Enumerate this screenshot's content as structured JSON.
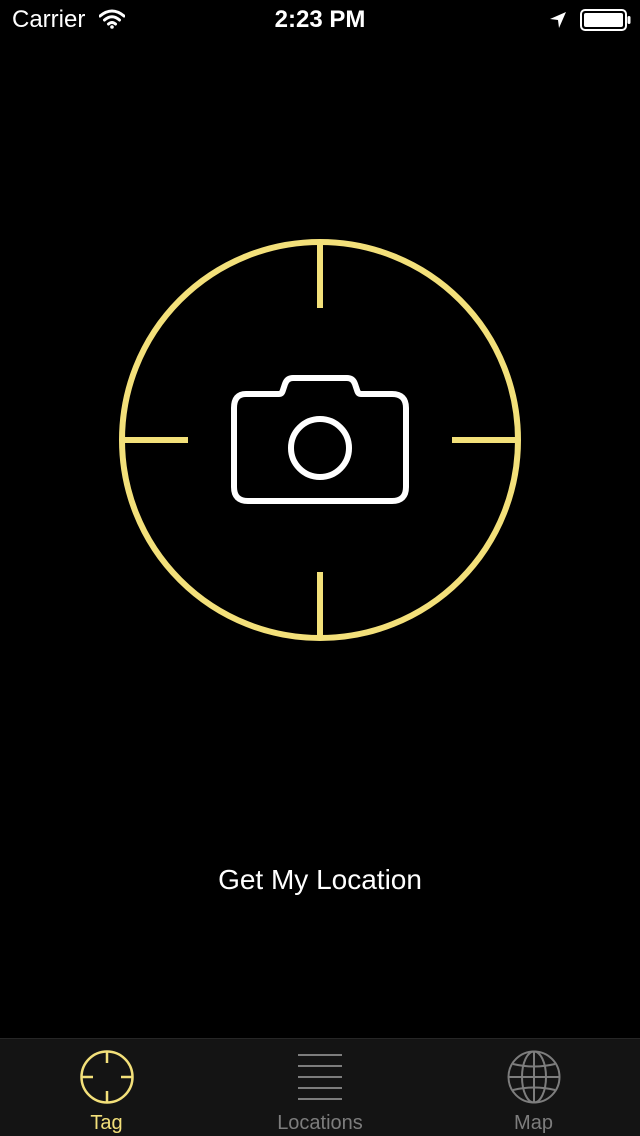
{
  "status_bar": {
    "carrier": "Carrier",
    "time": "2:23 PM",
    "icons": [
      "wifi-icon",
      "location-arrow-icon",
      "battery-icon"
    ]
  },
  "main": {
    "tag_button": {
      "icons": [
        "crosshair-ring",
        "camera-icon"
      ]
    },
    "get_location_label": "Get My Location"
  },
  "tab_bar": {
    "tabs": [
      {
        "label": "Tag",
        "icon": "crosshair-icon",
        "selected": true
      },
      {
        "label": "Locations",
        "icon": "list-lines-icon",
        "selected": false
      },
      {
        "label": "Map",
        "icon": "globe-icon",
        "selected": false
      }
    ]
  },
  "colors": {
    "background": "#000000",
    "accent_yellow": "#f3e07a",
    "tab_inactive": "#7d7d7d",
    "tab_bar_bg": "#141414",
    "text": "#ffffff"
  }
}
